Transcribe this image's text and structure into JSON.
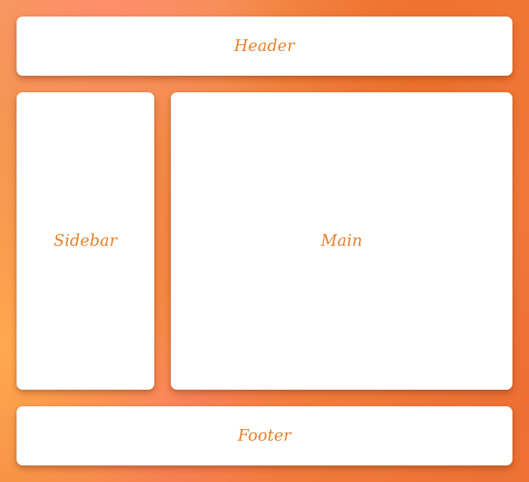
{
  "layout": {
    "header": {
      "label": "Header"
    },
    "sidebar": {
      "label": "Sidebar"
    },
    "main": {
      "label": "Main"
    },
    "footer": {
      "label": "Footer"
    }
  },
  "colors": {
    "label_text": "#eb7f28",
    "panel_background": "#ffffff",
    "page_background": "#f3823f"
  }
}
